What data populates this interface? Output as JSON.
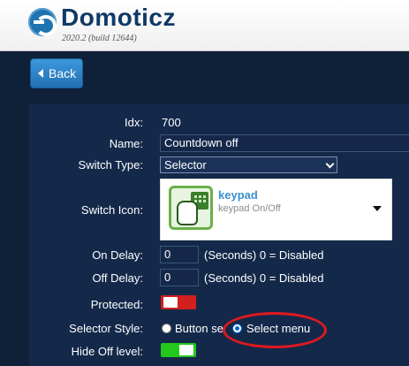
{
  "header": {
    "app_title": "Domoticz",
    "version": "2020.2 (build 12644)"
  },
  "nav": {
    "back_label": "Back"
  },
  "form": {
    "idx_label": "Idx:",
    "idx_value": "700",
    "name_label": "Name:",
    "name_value": "Countdown off",
    "switch_type_label": "Switch Type:",
    "switch_type_value": "Selector",
    "switch_icon_label": "Switch Icon:",
    "icon_title": "keypad",
    "icon_subtitle": "keypad On/Off",
    "on_delay_label": "On Delay:",
    "on_delay_value": "0",
    "on_delay_hint": "(Seconds) 0 = Disabled",
    "off_delay_label": "Off Delay:",
    "off_delay_value": "0",
    "off_delay_hint": "(Seconds) 0 = Disabled",
    "protected_label": "Protected:",
    "protected_on": false,
    "selector_style_label": "Selector Style:",
    "style_option_buttons": "Button se",
    "style_option_menu": "Select menu",
    "selected_style": "Select menu",
    "hide_off_label": "Hide Off level:",
    "hide_off_on": true
  },
  "colors": {
    "toggle_off": "#d21f1f",
    "toggle_on": "#22c91a",
    "highlight": "#e0191e",
    "accent": "#3b8fd0"
  },
  "icons": [
    "domoticz-logo-icon",
    "back-arrow-icon",
    "keypad-icon",
    "chevron-down-icon",
    "dropdown-triangle-icon"
  ]
}
